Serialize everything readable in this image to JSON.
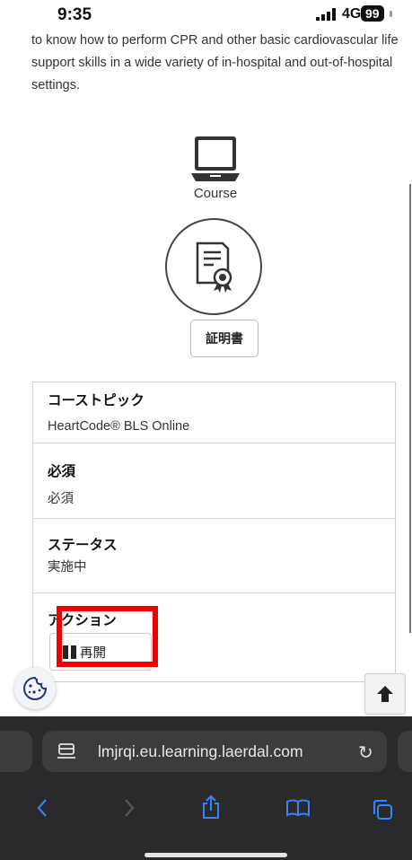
{
  "status_bar": {
    "time": "9:35",
    "network": "4G",
    "battery": "99"
  },
  "intro_text": "to know how to perform CPR and other basic cardiovascular life support skills in a wide variety of in-hospital and out-of-hospital settings.",
  "course": {
    "label": "Course",
    "icon": "laptop-icon"
  },
  "certificate": {
    "icon": "certificate-icon",
    "button_label": "証明書"
  },
  "details": {
    "topic_label": "コーストピック",
    "topic_value": "HeartCode® BLS Online",
    "required_label": "必須",
    "required_value": "必須",
    "status_label": "ステータス",
    "status_value": "実施中",
    "action_label": "アクション",
    "resume_label": "再開"
  },
  "browser": {
    "url": "lmjrqi.eu.learning.laerdal.com",
    "icons": [
      "page-settings-icon",
      "reload-icon",
      "back-icon",
      "forward-icon",
      "share-icon",
      "bookmarks-icon",
      "tabs-icon"
    ]
  },
  "colors": {
    "highlight": "#f00000",
    "toolbar_bg": "#2a2a2c",
    "toolbar_accent": "#3a82f7"
  }
}
